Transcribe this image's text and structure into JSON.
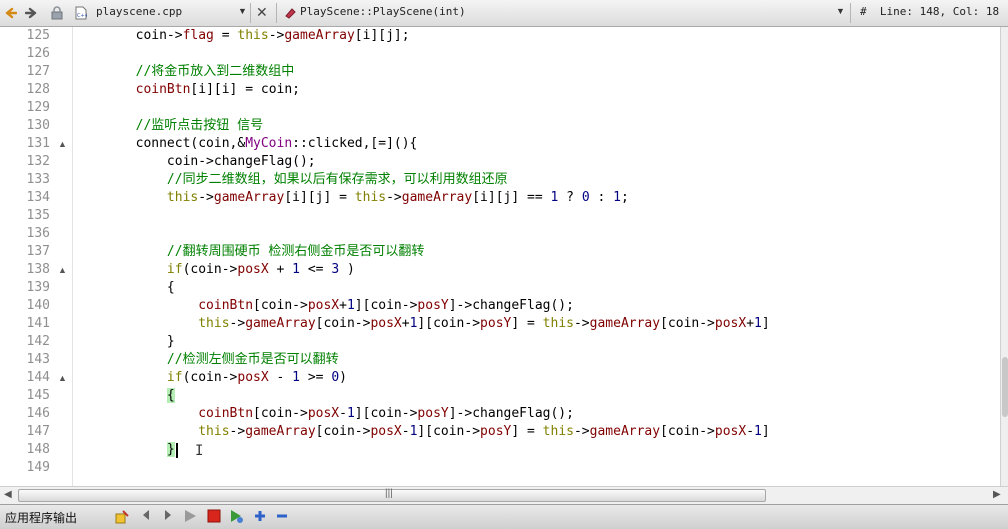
{
  "toolbar": {
    "back_icon": "◆",
    "forward_icon": "◆",
    "file_name": "playscene.cpp",
    "file_dropdown_icon": "▼",
    "close_icon": "✕",
    "symbol_name": "PlayScene::PlayScene(int)",
    "symbol_dropdown_icon": "▼",
    "position": "#  Line: 148, Col: 18"
  },
  "editor": {
    "lines": [
      {
        "num": "125",
        "fold": "",
        "tokens": [
          [
            "",
            "        coin->"
          ],
          [
            "t-mem",
            "flag"
          ],
          [
            "",
            " = "
          ],
          [
            "t-kw",
            "this"
          ],
          [
            "",
            "->"
          ],
          [
            "t-mem",
            "gameArray"
          ],
          [
            "",
            "[i][j];"
          ]
        ]
      },
      {
        "num": "126",
        "fold": "",
        "tokens": []
      },
      {
        "num": "127",
        "fold": "",
        "tokens": [
          [
            "",
            "        "
          ],
          [
            "t-cmt",
            "//将金币放入到二维数组中"
          ]
        ]
      },
      {
        "num": "128",
        "fold": "",
        "tokens": [
          [
            "",
            "        "
          ],
          [
            "t-mem",
            "coinBtn"
          ],
          [
            "",
            "[i][i] = coin;"
          ]
        ]
      },
      {
        "num": "129",
        "fold": "",
        "tokens": []
      },
      {
        "num": "130",
        "fold": "",
        "tokens": [
          [
            "",
            "        "
          ],
          [
            "t-cmt",
            "//监听点击按钮 信号"
          ]
        ]
      },
      {
        "num": "131",
        "fold": "▲",
        "tokens": [
          [
            "",
            "        connect(coin,&"
          ],
          [
            "t-ty",
            "MyCoin"
          ],
          [
            "",
            "::clicked,[=](){"
          ]
        ]
      },
      {
        "num": "132",
        "fold": "",
        "tokens": [
          [
            "",
            "            coin->changeFlag();"
          ]
        ]
      },
      {
        "num": "133",
        "fold": "",
        "tokens": [
          [
            "",
            "            "
          ],
          [
            "t-cmt",
            "//同步二维数组，如果以后有保存需求，可以利用数组还原"
          ]
        ]
      },
      {
        "num": "134",
        "fold": "",
        "tokens": [
          [
            "",
            "            "
          ],
          [
            "t-kw",
            "this"
          ],
          [
            "",
            "->"
          ],
          [
            "t-mem",
            "gameArray"
          ],
          [
            "",
            "[i][j] = "
          ],
          [
            "t-kw",
            "this"
          ],
          [
            "",
            "->"
          ],
          [
            "t-mem",
            "gameArray"
          ],
          [
            "",
            "[i][j] == "
          ],
          [
            "t-num",
            "1"
          ],
          [
            "",
            " ? "
          ],
          [
            "t-num",
            "0"
          ],
          [
            "",
            " : "
          ],
          [
            "t-num",
            "1"
          ],
          [
            "",
            ";"
          ]
        ]
      },
      {
        "num": "135",
        "fold": "",
        "tokens": []
      },
      {
        "num": "136",
        "fold": "",
        "tokens": []
      },
      {
        "num": "137",
        "fold": "",
        "tokens": [
          [
            "",
            "            "
          ],
          [
            "t-cmt",
            "//翻转周围硬币 检测右侧金币是否可以翻转"
          ]
        ]
      },
      {
        "num": "138",
        "fold": "▲",
        "tokens": [
          [
            "",
            "            "
          ],
          [
            "t-kw",
            "if"
          ],
          [
            "",
            "(coin->"
          ],
          [
            "t-mem",
            "posX"
          ],
          [
            "",
            " + "
          ],
          [
            "t-num",
            "1"
          ],
          [
            "",
            " <= "
          ],
          [
            "t-num",
            "3"
          ],
          [
            "",
            " )"
          ]
        ]
      },
      {
        "num": "139",
        "fold": "",
        "tokens": [
          [
            "",
            "            {"
          ]
        ]
      },
      {
        "num": "140",
        "fold": "",
        "tokens": [
          [
            "",
            "                "
          ],
          [
            "t-mem",
            "coinBtn"
          ],
          [
            "",
            "[coin->"
          ],
          [
            "t-mem",
            "posX"
          ],
          [
            "",
            "+"
          ],
          [
            "t-num",
            "1"
          ],
          [
            "",
            "][coin->"
          ],
          [
            "t-mem",
            "posY"
          ],
          [
            "",
            "]->changeFlag();"
          ]
        ]
      },
      {
        "num": "141",
        "fold": "",
        "tokens": [
          [
            "",
            "                "
          ],
          [
            "t-kw",
            "this"
          ],
          [
            "",
            "->"
          ],
          [
            "t-mem",
            "gameArray"
          ],
          [
            "",
            "[coin->"
          ],
          [
            "t-mem",
            "posX"
          ],
          [
            "",
            "+"
          ],
          [
            "t-num",
            "1"
          ],
          [
            "",
            "][coin->"
          ],
          [
            "t-mem",
            "posY"
          ],
          [
            "",
            "] = "
          ],
          [
            "t-kw",
            "this"
          ],
          [
            "",
            "->"
          ],
          [
            "t-mem",
            "gameArray"
          ],
          [
            "",
            "[coin->"
          ],
          [
            "t-mem",
            "posX"
          ],
          [
            "",
            "+"
          ],
          [
            "t-num",
            "1"
          ],
          [
            "",
            "]"
          ]
        ]
      },
      {
        "num": "142",
        "fold": "",
        "tokens": [
          [
            "",
            "            }"
          ]
        ]
      },
      {
        "num": "143",
        "fold": "",
        "tokens": [
          [
            "",
            "            "
          ],
          [
            "t-cmt",
            "//检测左侧金币是否可以翻转"
          ]
        ]
      },
      {
        "num": "144",
        "fold": "▲",
        "tokens": [
          [
            "",
            "            "
          ],
          [
            "t-kw",
            "if"
          ],
          [
            "",
            "(coin->"
          ],
          [
            "t-mem",
            "posX"
          ],
          [
            "",
            " - "
          ],
          [
            "t-num",
            "1"
          ],
          [
            "",
            " >= "
          ],
          [
            "t-num",
            "0"
          ],
          [
            "",
            ")"
          ]
        ]
      },
      {
        "num": "145",
        "fold": "",
        "tokens": [
          [
            "",
            "            "
          ],
          [
            "brace-hl",
            "{"
          ]
        ]
      },
      {
        "num": "146",
        "fold": "",
        "tokens": [
          [
            "",
            "                "
          ],
          [
            "t-mem",
            "coinBtn"
          ],
          [
            "",
            "[coin->"
          ],
          [
            "t-mem",
            "posX"
          ],
          [
            "",
            "-"
          ],
          [
            "t-num",
            "1"
          ],
          [
            "",
            "][coin->"
          ],
          [
            "t-mem",
            "posY"
          ],
          [
            "",
            "]->changeFlag();"
          ]
        ]
      },
      {
        "num": "147",
        "fold": "",
        "tokens": [
          [
            "",
            "                "
          ],
          [
            "t-kw",
            "this"
          ],
          [
            "",
            "->"
          ],
          [
            "t-mem",
            "gameArray"
          ],
          [
            "",
            "[coin->"
          ],
          [
            "t-mem",
            "posX"
          ],
          [
            "",
            "-"
          ],
          [
            "t-num",
            "1"
          ],
          [
            "",
            "][coin->"
          ],
          [
            "t-mem",
            "posY"
          ],
          [
            "",
            "] = "
          ],
          [
            "t-kw",
            "this"
          ],
          [
            "",
            "->"
          ],
          [
            "t-mem",
            "gameArray"
          ],
          [
            "",
            "[coin->"
          ],
          [
            "t-mem",
            "posX"
          ],
          [
            "",
            "-"
          ],
          [
            "t-num",
            "1"
          ],
          [
            "",
            "]"
          ]
        ]
      },
      {
        "num": "148",
        "fold": "",
        "tokens": [
          [
            "",
            "            "
          ],
          [
            "brace-hl",
            "}"
          ]
        ]
      },
      {
        "num": "149",
        "fold": "",
        "tokens": []
      }
    ]
  },
  "output_panel": {
    "title": "应用程序输出"
  },
  "colors": {
    "keyword": "#808000",
    "member": "#800000",
    "type": "#800080",
    "number": "#000080",
    "comment": "#008000",
    "brace_highlight": "#b4eeb4"
  }
}
